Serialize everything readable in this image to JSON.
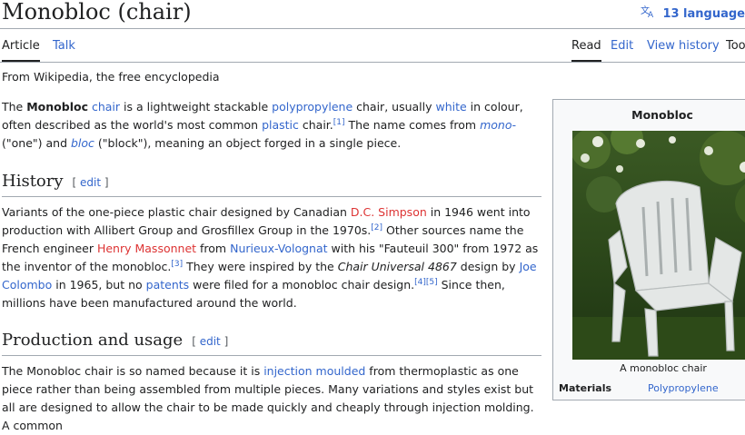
{
  "header": {
    "title": "Monobloc (chair)",
    "languages_label": "13 language"
  },
  "tabs": {
    "left": [
      "Article",
      "Talk"
    ],
    "right": [
      "Read",
      "Edit",
      "View history",
      "Too"
    ]
  },
  "tagline": "From Wikipedia, the free encyclopedia",
  "intro": {
    "t1": "The ",
    "bold": "Monobloc",
    "t2": " ",
    "l_chair": "chair",
    "t3": " is a lightweight stackable ",
    "l_pp": "polypropylene",
    "t4": " chair, usually ",
    "l_white": "white",
    "t5": " in colour, often described as the world's most common ",
    "l_plastic": "plastic",
    "t6": " chair.",
    "ref1": "[1]",
    "t7": " The name comes from ",
    "l_mono": "mono-",
    "t8": " (\"one\") and ",
    "l_bloc": "bloc",
    "t9": " (\"block\"), meaning an object forged in a single piece."
  },
  "history": {
    "heading": "History",
    "edit": "edit",
    "t1": "Variants of the one-piece plastic chair designed by Canadian ",
    "l_simpson": "D.C. Simpson",
    "t2": " in 1946 went into production with Allibert Group and Grosfillex Group in the 1970s.",
    "ref2": "[2]",
    "t3": " Other sources name the French engineer ",
    "l_massonnet": "Henry Massonnet",
    "t4": " from ",
    "l_nurieux": "Nurieux-Volognat",
    "t5": " with his \"Fauteuil 300\" from 1972 as the inventor of the monobloc.",
    "ref3": "[3]",
    "t6": " They were inspired by the ",
    "italic": "Chair Universal 4867",
    "t7": " design by ",
    "l_colombo": "Joe Colombo",
    "t8": " in 1965, but no ",
    "l_patents": "patents",
    "t9": " were filed for a monobloc chair design.",
    "ref45": "[4][5]",
    "t10": " Since then, millions have been manufactured around the world."
  },
  "production": {
    "heading": "Production and usage",
    "edit": "edit",
    "t1": "The Monobloc chair is so named because it is ",
    "l_injection": "injection moulded",
    "t2": " from thermoplastic as one piece rather than being assembled from multiple pieces. Many variations and styles exist but all are designed to allow the chair to be made quickly and cheaply through injection molding. A common"
  },
  "infobox": {
    "title": "Monobloc",
    "caption": "A monobloc chair",
    "materials_label": "Materials",
    "materials_value": "Polypropylene"
  },
  "colors": {
    "link": "#3366cc",
    "redlink": "#d33",
    "border": "#a2a9b1",
    "text": "#202122"
  },
  "icons": {
    "languages": "translate-icon"
  }
}
